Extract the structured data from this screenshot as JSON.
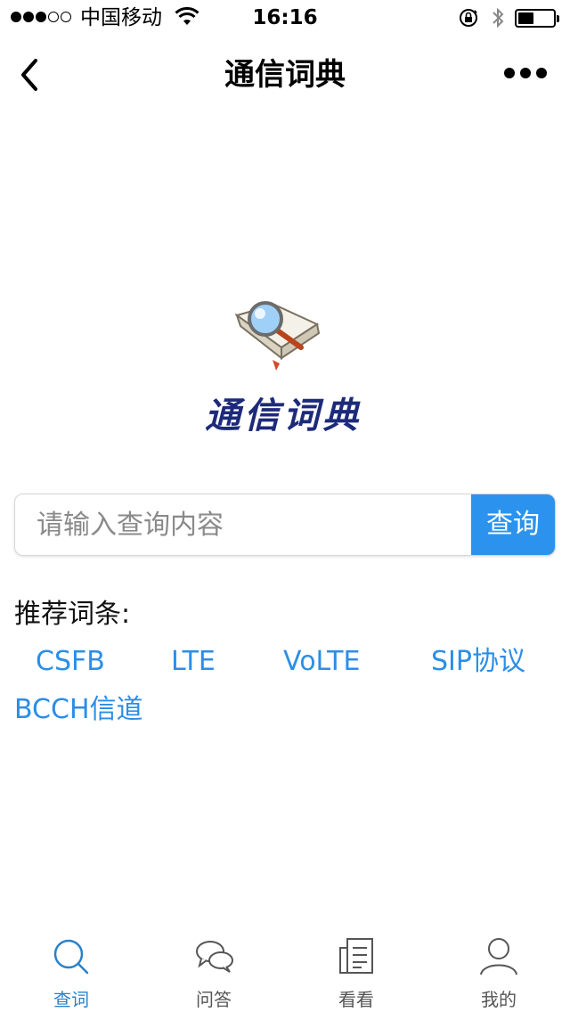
{
  "status_bar": {
    "carrier": "中国移动",
    "time": "16:16",
    "battery_level": 0.45
  },
  "nav": {
    "title": "通信词典"
  },
  "logo": {
    "text": "通信词典"
  },
  "search": {
    "placeholder": "请输入查询内容",
    "value": "",
    "button_label": "查询"
  },
  "recommended": {
    "label": "推荐词条:",
    "items": [
      "CSFB",
      "LTE",
      "VoLTE",
      "SIP协议",
      "BCCH信道"
    ]
  },
  "tabs": [
    {
      "label": "查词",
      "icon": "search-icon",
      "active": true
    },
    {
      "label": "问答",
      "icon": "chat-bubbles-icon",
      "active": false
    },
    {
      "label": "看看",
      "icon": "document-icon",
      "active": false
    },
    {
      "label": "我的",
      "icon": "person-icon",
      "active": false
    }
  ],
  "colors": {
    "accent": "#2b93ee",
    "link": "#2b8ee8",
    "active_tab": "#2a82c8",
    "logo_text": "#1d2a7a"
  }
}
